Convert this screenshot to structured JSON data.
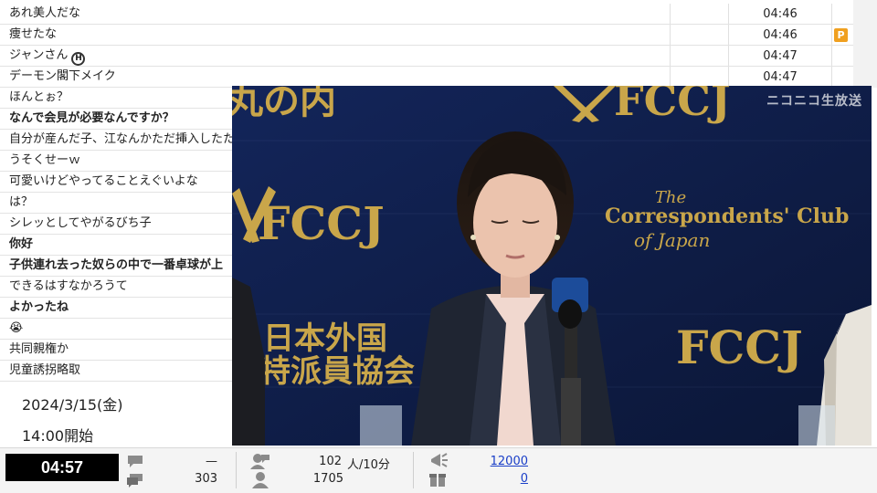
{
  "comments": [
    {
      "text": "あれ美人だな",
      "time": "04:46",
      "bold": false,
      "flag": ""
    },
    {
      "text": "痩せたな",
      "time": "04:46",
      "bold": false,
      "flag": "P"
    },
    {
      "text": "ジャンさん",
      "time": "04:47",
      "bold": false,
      "flag": "",
      "icon": "H"
    },
    {
      "text": "デーモン閣下メイク",
      "time": "04:47",
      "bold": false,
      "flag": ""
    },
    {
      "text": "ほんとぉ？",
      "time": "",
      "bold": false,
      "flag": ""
    },
    {
      "text": "なんで会見が必要なんですか？",
      "time": "",
      "bold": true,
      "flag": ""
    },
    {
      "text": "自分が産んだ子、江なんかただ挿入したた",
      "time": "",
      "bold": false,
      "flag": ""
    },
    {
      "text": "うそくせーｗ",
      "time": "",
      "bold": false,
      "flag": ""
    },
    {
      "text": "可愛いけどやってることえぐいよな",
      "time": "",
      "bold": false,
      "flag": ""
    },
    {
      "text": "は？",
      "time": "",
      "bold": false,
      "flag": ""
    },
    {
      "text": "シレッとしてやがるびち子",
      "time": "",
      "bold": false,
      "flag": ""
    },
    {
      "text": "你好",
      "time": "",
      "bold": true,
      "flag": ""
    },
    {
      "text": "子供連れ去った奴らの中で一番卓球が上",
      "time": "",
      "bold": true,
      "flag": ""
    },
    {
      "text": "できるはすなかろうて",
      "time": "",
      "bold": false,
      "flag": ""
    },
    {
      "text": "よかったね",
      "time": "",
      "bold": true,
      "flag": ""
    },
    {
      "text": "😭",
      "time": "",
      "bold": false,
      "flag": ""
    },
    {
      "text": "共同親権か",
      "time": "",
      "bold": false,
      "flag": ""
    },
    {
      "text": "児童誘拐略取",
      "time": "",
      "bold": false,
      "flag": ""
    }
  ],
  "video": {
    "watermark": "ニコニコ生放送",
    "backdrop_left_top": "丸の内",
    "logo_text": "FCCJ",
    "club_line1": "The",
    "club_line2": "Correspondents' Club",
    "club_line3": "of Japan",
    "kanji_line1": "日本外国",
    "kanji_line2": "特派員協会"
  },
  "info": {
    "date": "2024/3/15(金)",
    "start": "14:00開始"
  },
  "bottom": {
    "elapsed": "04:57",
    "comment_rate": "—",
    "comment_total": "303",
    "viewers_rate_value": "102",
    "viewers_rate_unit": "人/10分",
    "viewers_total": "1705",
    "ad_points": "12000",
    "gift_points": "0"
  },
  "colors": {
    "badge": "#f0a020",
    "backdrop": "#0f1d44",
    "gold": "#c9a64a",
    "link": "#1a3fc8"
  }
}
